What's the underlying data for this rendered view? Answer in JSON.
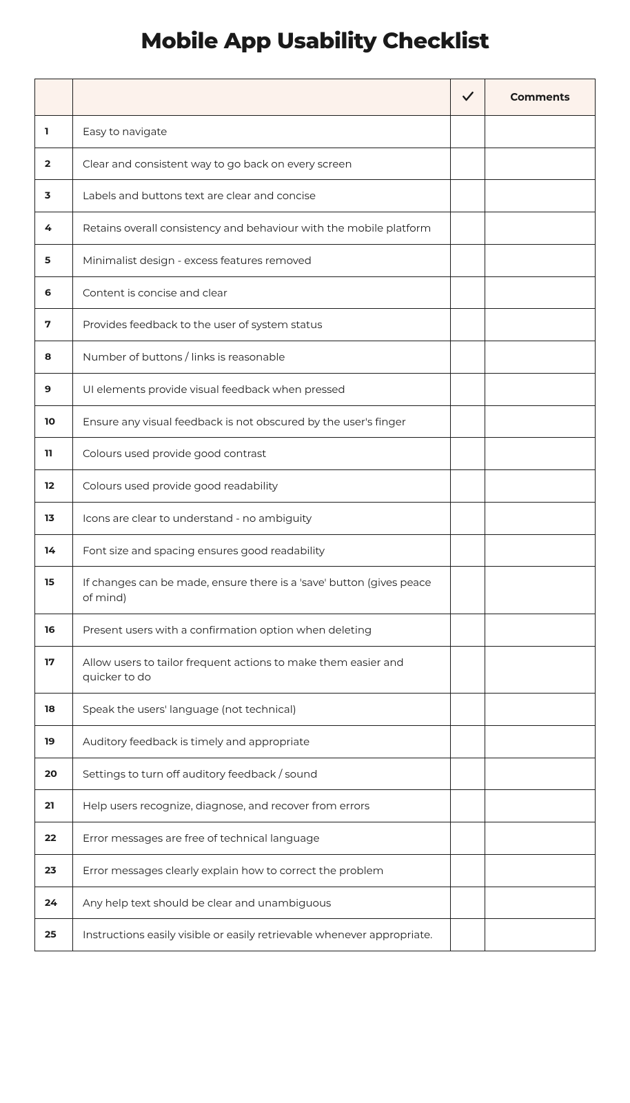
{
  "title": "Mobile App Usability Checklist",
  "headers": {
    "num": "",
    "item": "",
    "check_icon": "check",
    "comments": "Comments"
  },
  "rows": [
    {
      "n": "1",
      "text": "Easy to navigate"
    },
    {
      "n": "2",
      "text": "Clear and consistent way to go back on every screen"
    },
    {
      "n": "3",
      "text": "Labels and buttons text are clear and concise"
    },
    {
      "n": "4",
      "text": "Retains overall consistency and behaviour with the mobile platform"
    },
    {
      "n": "5",
      "text": "Minimalist design - excess features removed"
    },
    {
      "n": "6",
      "text": "Content is concise and clear"
    },
    {
      "n": "7",
      "text": "Provides feedback to the user of system status"
    },
    {
      "n": "8",
      "text": "Number of buttons / links is reasonable"
    },
    {
      "n": "9",
      "text": "UI elements provide visual feedback when pressed"
    },
    {
      "n": "10",
      "text": "Ensure any visual feedback is not obscured by the user's finger"
    },
    {
      "n": "11",
      "text": "Colours used provide good contrast"
    },
    {
      "n": "12",
      "text": "Colours used provide good readability"
    },
    {
      "n": "13",
      "text": "Icons are clear to understand - no ambiguity"
    },
    {
      "n": "14",
      "text": "Font size and spacing ensures good readability"
    },
    {
      "n": "15",
      "text": "If changes can be made, ensure there is a 'save' button (gives peace of mind)"
    },
    {
      "n": "16",
      "text": "Present users with a confirmation option when deleting"
    },
    {
      "n": "17",
      "text": "Allow users to tailor frequent actions to make them easier and quicker to do"
    },
    {
      "n": "18",
      "text": "Speak the users' language (not technical)"
    },
    {
      "n": "19",
      "text": "Auditory feedback is timely and appropriate"
    },
    {
      "n": "20",
      "text": "Settings to turn off auditory feedback / sound"
    },
    {
      "n": "21",
      "text": "Help users recognize, diagnose, and recover from errors"
    },
    {
      "n": "22",
      "text": "Error messages are free of technical language"
    },
    {
      "n": "23",
      "text": "Error messages clearly explain how to correct the problem"
    },
    {
      "n": "24",
      "text": "Any help text should be clear and unambiguous"
    },
    {
      "n": "25",
      "text": "Instructions easily visible or easily retrievable whenever appropriate."
    }
  ]
}
